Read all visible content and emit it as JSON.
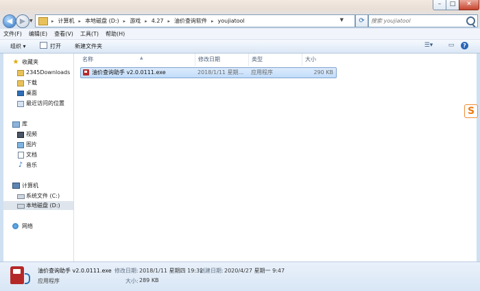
{
  "address": {
    "crumbs": [
      "计算机",
      "本地磁盘 (D:)",
      "游戏",
      "4.27",
      "油价查询软件",
      "youjiatool"
    ]
  },
  "search": {
    "placeholder": "搜索 youjiatool"
  },
  "menu": [
    "文件(F)",
    "编辑(E)",
    "查看(V)",
    "工具(T)",
    "帮助(H)"
  ],
  "toolbar": {
    "organize": "组织 ▾",
    "open": "打开",
    "new_folder": "新建文件夹"
  },
  "nav": {
    "favorites": "收藏夹",
    "downloads": "2345Downloads",
    "download": "下载",
    "desktop": "桌面",
    "recent": "最近访问的位置",
    "libraries": "库",
    "videos": "视频",
    "pictures": "图片",
    "documents": "文档",
    "music": "音乐",
    "computer": "计算机",
    "drive_c": "系统文件 (C:)",
    "drive_d": "本地磁盘 (D:)",
    "network": "网络"
  },
  "columns": {
    "name": "名称",
    "date": "修改日期",
    "type": "类型",
    "size": "大小"
  },
  "files": [
    {
      "name": "油价查询助手 v2.0.0111.exe",
      "date": "2018/1/11 星期...",
      "type": "应用程序",
      "size": "290 KB"
    }
  ],
  "status": {
    "name": "油价查询助手 v2.0.0111.exe",
    "type": "应用程序",
    "modified_label": "修改日期:",
    "modified": "2018/1/11 星期四 19:32",
    "created_label": "创建日期:",
    "created": "2020/4/27 星期一 9:47",
    "size_label": "大小:",
    "size": "289 KB"
  }
}
